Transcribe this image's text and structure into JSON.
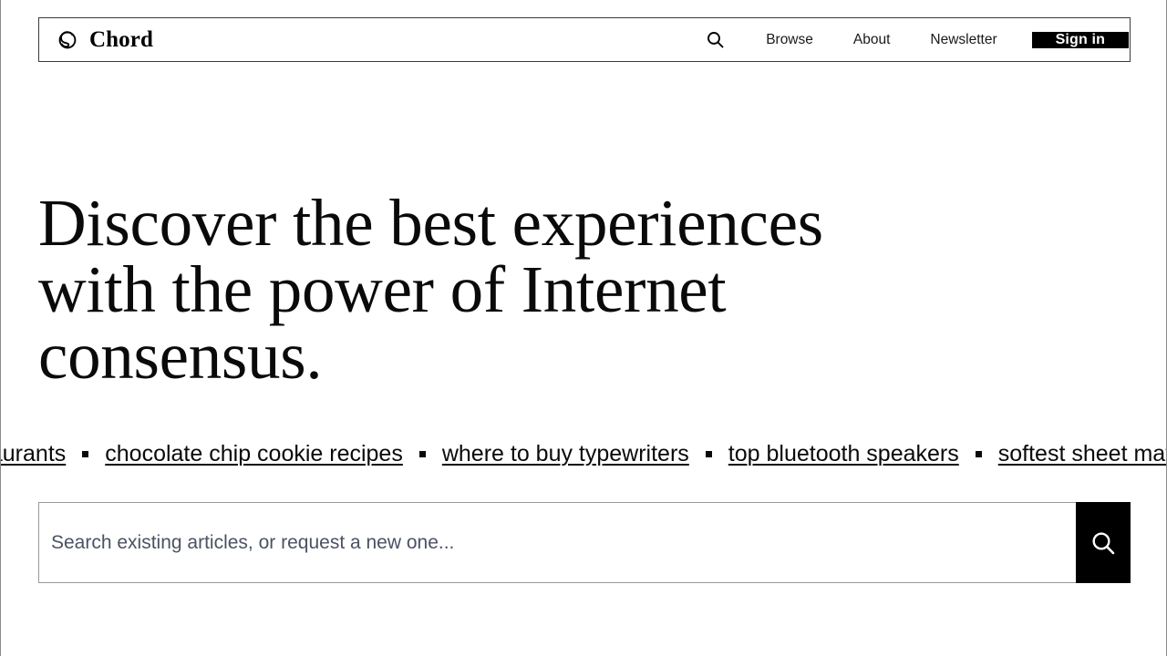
{
  "brand": {
    "name": "Chord",
    "logo_icon": "chord-spiral-logo-icon"
  },
  "header": {
    "search_icon": "search-icon",
    "nav_links": [
      {
        "label": "Browse"
      },
      {
        "label": "About"
      },
      {
        "label": "Newsletter"
      }
    ],
    "signin_label": "Sign in"
  },
  "hero": {
    "title": "Discover the best experiences\nwith the power of Internet\nconsensus."
  },
  "ticker": {
    "items": [
      {
        "label": "best restaurants"
      },
      {
        "label": "chocolate chip cookie recipes"
      },
      {
        "label": "where to buy typewriters"
      },
      {
        "label": "top bluetooth speakers"
      },
      {
        "label": "softest sheet materials"
      }
    ]
  },
  "search": {
    "value": "",
    "placeholder": "Search existing articles, or request a new one...",
    "submit_icon": "search-icon"
  },
  "colors": {
    "accent": "#000000",
    "text": "#0a0a0a",
    "placeholder": "#4b5263",
    "border": "#3a3a3a",
    "input_border": "#9a9a9a"
  }
}
